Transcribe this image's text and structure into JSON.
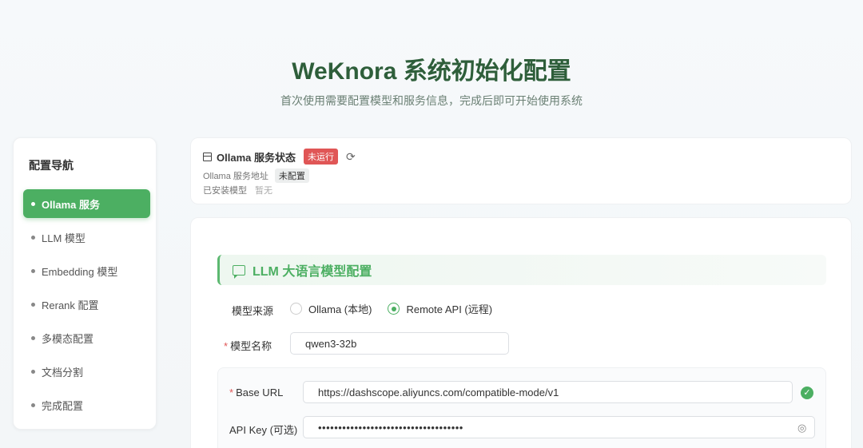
{
  "header": {
    "title": "WeKnora 系统初始化配置",
    "subtitle": "首次使用需要配置模型和服务信息，完成后即可开始使用系统"
  },
  "sidebar": {
    "title": "配置导航",
    "items": [
      {
        "label": "Ollama 服务"
      },
      {
        "label": "LLM 模型"
      },
      {
        "label": "Embedding 模型"
      },
      {
        "label": "Rerank 配置"
      },
      {
        "label": "多模态配置"
      },
      {
        "label": "文档分割"
      },
      {
        "label": "完成配置"
      }
    ],
    "active_index": 0
  },
  "ollama_status": {
    "title": "Ollama 服务状态",
    "status_badge": "未运行",
    "address_label": "Ollama 服务地址",
    "address_value": "未配置",
    "models_label": "已安装模型",
    "models_value": "暂无"
  },
  "llm_section": {
    "title": "LLM 大语言模型配置",
    "source_label": "模型来源",
    "source_options": [
      {
        "label": "Ollama (本地)",
        "checked": false
      },
      {
        "label": "Remote API (远程)",
        "checked": true
      }
    ],
    "model_name_label": "模型名称",
    "model_name_value": "qwen3-32b",
    "base_url_label": "Base URL",
    "base_url_value": "https://dashscope.aliyuncs.com/compatible-mode/v1",
    "api_key_label": "API Key (可选)",
    "api_key_value": "••••••••••••••••••••••••••••••••••••"
  },
  "colors": {
    "accent": "#4caf62",
    "title": "#2e5e3a",
    "danger": "#e05656"
  }
}
